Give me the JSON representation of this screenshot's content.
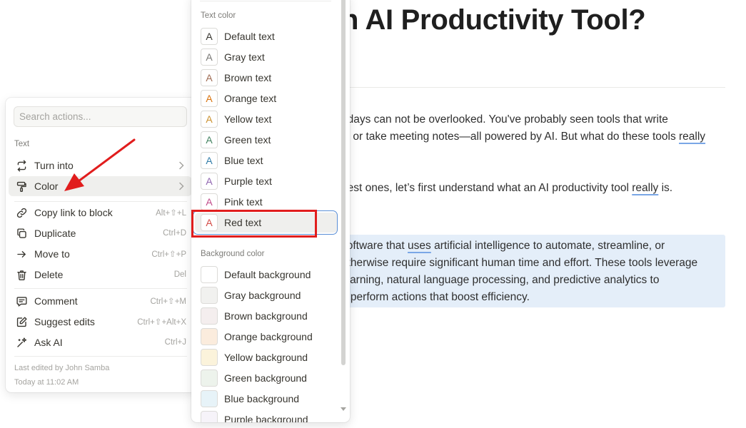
{
  "document": {
    "title": "n AI Productivity Tool?",
    "para1": {
      "line1": "adays can not be overlooked.  You've probably seen tools that write",
      "line2_pre": "s, or take meeting notes—all powered by AI. But what do these tools ",
      "line2_underlined": "really"
    },
    "para2": {
      "pre": "best ones, let’s first understand what an AI productivity tool ",
      "underlined": "really",
      "post": " is."
    },
    "callout": {
      "line1_pre": "software that ",
      "line1_underlined": "uses",
      "line1_post": " artificial intelligence to automate, streamline, or",
      "line2": "otherwise require significant human time and effort. These tools leverage",
      "line3": " learning, natural language processing, and predictive analytics to",
      "line4": "d perform actions that boost efficiency.",
      "bg_color": "#e4eef9"
    }
  },
  "actions_menu": {
    "search_placeholder": "Search actions...",
    "section_label": "Text",
    "items": [
      {
        "label": "Turn into",
        "icon": "turn-into-icon",
        "shortcut": "",
        "submenu": true
      },
      {
        "label": "Color",
        "icon": "paint-roller-icon",
        "shortcut": "",
        "submenu": true,
        "highlighted": true
      },
      {
        "label": "Copy link to block",
        "icon": "link-icon",
        "shortcut": "Alt+⇧+L"
      },
      {
        "label": "Duplicate",
        "icon": "duplicate-icon",
        "shortcut": "Ctrl+D"
      },
      {
        "label": "Move to",
        "icon": "arrow-right-icon",
        "shortcut": "Ctrl+⇧+P"
      },
      {
        "label": "Delete",
        "icon": "trash-icon",
        "shortcut": "Del"
      },
      {
        "label": "Comment",
        "icon": "comment-icon",
        "shortcut": "Ctrl+⇧+M"
      },
      {
        "label": "Suggest edits",
        "icon": "suggest-edits-icon",
        "shortcut": "Ctrl+⇧+Alt+X"
      },
      {
        "label": "Ask AI",
        "icon": "ai-sparkle-icon",
        "shortcut": "Ctrl+J"
      }
    ],
    "footer": {
      "edited_by": "Last edited by John Samba",
      "edited_at": "Today at 11:02 AM"
    }
  },
  "color_menu": {
    "text_section": "Text color",
    "text_colors": [
      {
        "label": "Default text",
        "color": "#37352f"
      },
      {
        "label": "Gray text",
        "color": "#787774"
      },
      {
        "label": "Brown text",
        "color": "#9f6b53"
      },
      {
        "label": "Orange text",
        "color": "#d9730d"
      },
      {
        "label": "Yellow text",
        "color": "#cb912f"
      },
      {
        "label": "Green text",
        "color": "#448361"
      },
      {
        "label": "Blue text",
        "color": "#337ea9"
      },
      {
        "label": "Purple text",
        "color": "#9065b0"
      },
      {
        "label": "Pink text",
        "color": "#c14c8a"
      },
      {
        "label": "Red text",
        "color": "#d44c47",
        "selected": true
      }
    ],
    "background_section": "Background color",
    "background_colors": [
      {
        "label": "Default background",
        "color": "#ffffff"
      },
      {
        "label": "Gray background",
        "color": "#f1f1ef"
      },
      {
        "label": "Brown background",
        "color": "#f4eeee"
      },
      {
        "label": "Orange background",
        "color": "#fbecdd"
      },
      {
        "label": "Yellow background",
        "color": "#fbf3db"
      },
      {
        "label": "Green background",
        "color": "#edf3ec"
      },
      {
        "label": "Blue background",
        "color": "#e7f3f8"
      },
      {
        "label": "Purple background",
        "color": "#f6f3f9"
      }
    ],
    "swatch_letter": "A"
  },
  "annotation": {
    "color": "#e11d1d"
  }
}
